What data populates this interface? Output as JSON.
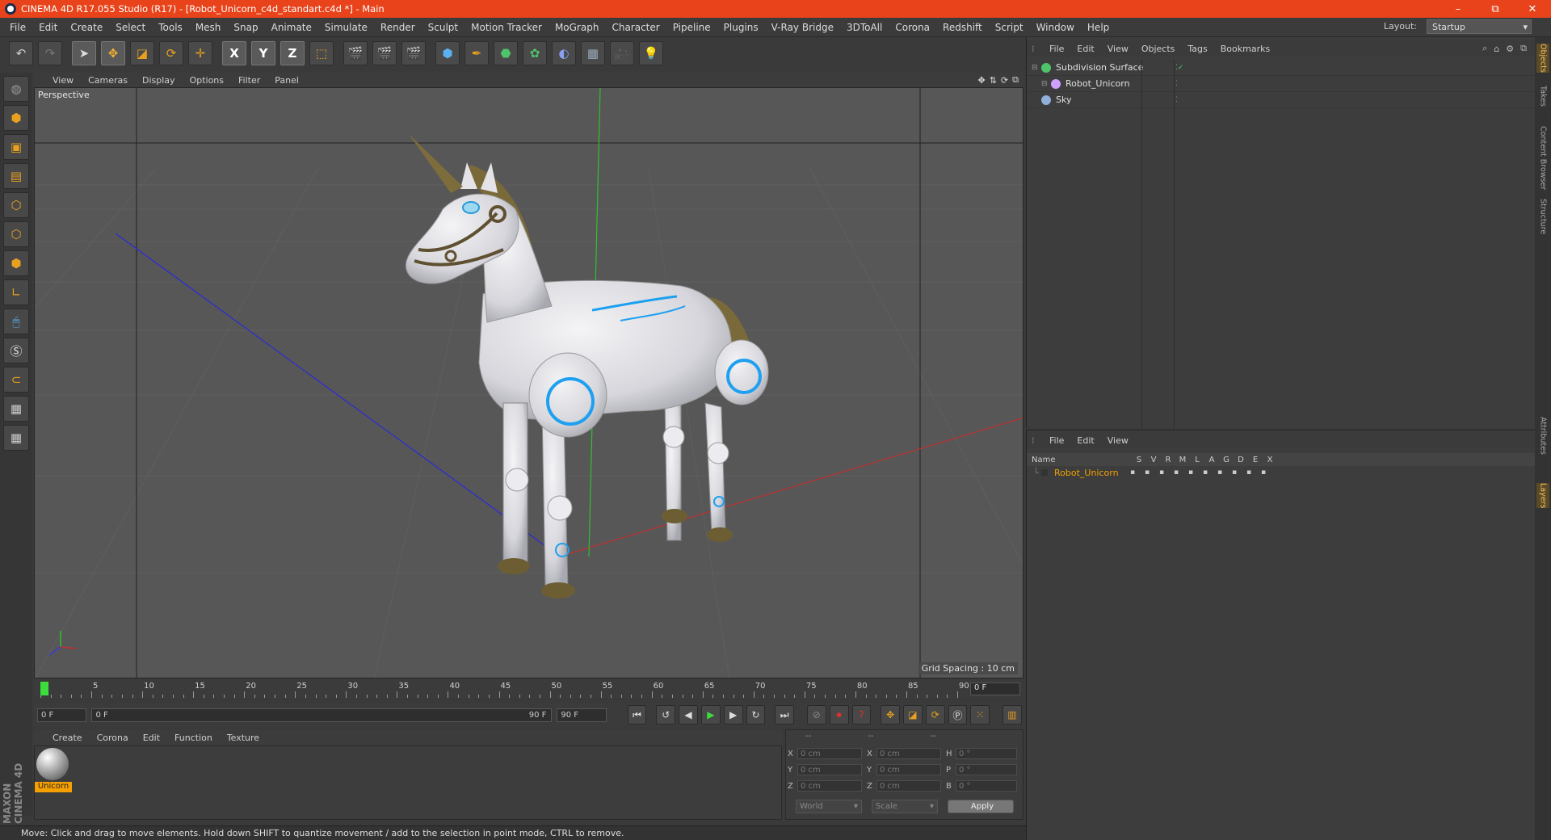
{
  "window": {
    "title": "CINEMA 4D R17.055 Studio (R17) - [Robot_Unicorn_c4d_standart.c4d *] - Main",
    "minimize": "–",
    "restore": "⧉",
    "close": "✕"
  },
  "menu": [
    "File",
    "Edit",
    "Create",
    "Select",
    "Tools",
    "Mesh",
    "Snap",
    "Animate",
    "Simulate",
    "Render",
    "Sculpt",
    "Motion Tracker",
    "MoGraph",
    "Character",
    "Pipeline",
    "Plugins",
    "V-Ray Bridge",
    "3DToAll",
    "Corona",
    "Redshift",
    "Script",
    "Window",
    "Help"
  ],
  "layout": {
    "label": "Layout:",
    "value": "Startup"
  },
  "toolbar": {
    "undo_icon": "undo-icon",
    "redo_icon": "redo-icon",
    "axis_x": "X",
    "axis_y": "Y",
    "axis_z": "Z"
  },
  "viewport": {
    "menu": [
      "View",
      "Cameras",
      "Display",
      "Options",
      "Filter",
      "Panel"
    ],
    "camera_label": "Perspective",
    "grid_spacing": "Grid Spacing : 10 cm"
  },
  "timeline": {
    "ticks": [
      "0",
      "5",
      "10",
      "15",
      "20",
      "25",
      "30",
      "35",
      "40",
      "45",
      "50",
      "55",
      "60",
      "65",
      "70",
      "75",
      "80",
      "85",
      "90"
    ],
    "current_frame": "0 F"
  },
  "transport": {
    "start_field": "0 F",
    "range_start": "0 F",
    "range_end": "90 F",
    "end_field": "90 F"
  },
  "materials": {
    "menu": [
      "Create",
      "Corona",
      "Edit",
      "Function",
      "Texture"
    ],
    "items": [
      {
        "name": "Unicorn"
      }
    ]
  },
  "coordinates": {
    "headers": [
      "--",
      "--",
      "--"
    ],
    "rows": [
      {
        "l1": "X",
        "v1": "0 cm",
        "l2": "X",
        "v2": "0 cm",
        "l3": "H",
        "v3": "0 °"
      },
      {
        "l1": "Y",
        "v1": "0 cm",
        "l2": "Y",
        "v2": "0 cm",
        "l3": "P",
        "v3": "0 °"
      },
      {
        "l1": "Z",
        "v1": "0 cm",
        "l2": "Z",
        "v2": "0 cm",
        "l3": "B",
        "v3": "0 °"
      }
    ],
    "mode": "World",
    "size_mode": "Scale",
    "apply": "Apply"
  },
  "status": "Move: Click and drag to move elements. Hold down SHIFT to quantize movement / add to the selection in point mode, CTRL to remove.",
  "brand": "MAXON CINEMA 4D",
  "objects": {
    "menu": [
      "File",
      "Edit",
      "View",
      "Objects",
      "Tags",
      "Bookmarks"
    ],
    "items": [
      {
        "name": "Subdivision Surface",
        "color": "#4fc36a"
      },
      {
        "name": "Robot_Unicorn",
        "color": "#cfa0ff"
      },
      {
        "name": "Sky",
        "color": "#8fb0d8"
      }
    ]
  },
  "layers": {
    "menu": [
      "File",
      "Edit",
      "View"
    ],
    "columns": [
      "Name",
      "S",
      "V",
      "R",
      "M",
      "L",
      "A",
      "G",
      "D",
      "E",
      "X"
    ],
    "items": [
      {
        "name": "Robot_Unicorn",
        "color": "#f5a000"
      }
    ]
  },
  "side_tabs": [
    "Objects",
    "Takes",
    "Content Browser",
    "Structure",
    "Attributes",
    "Layers"
  ]
}
